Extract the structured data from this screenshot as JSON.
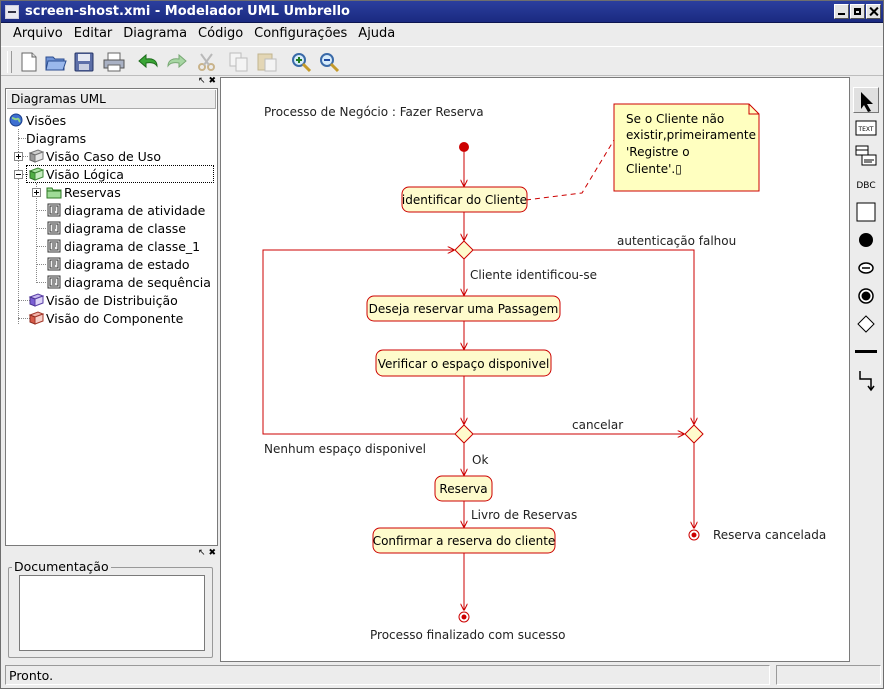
{
  "window": {
    "title": "screen-shost.xmi - Modelador UML Umbrello"
  },
  "menu": [
    "Arquivo",
    "Editar",
    "Diagrama",
    "Código",
    "Configurações",
    "Ajuda"
  ],
  "tree": {
    "header": "Diagramas UML",
    "root": "Visões",
    "diagrams": "Diagrams",
    "caso_de_uso": "Visão Caso de Uso",
    "logica": "Visão Lógica",
    "reservas": "Reservas",
    "diagrama_atividade": "diagrama de atividade",
    "diagrama_classe": "diagrama de classe",
    "diagrama_classe_1": "diagrama de classe_1",
    "diagrama_estado": "diagrama de estado",
    "diagrama_sequencia": "diagrama de sequência",
    "distribuicao": "Visão de Distribuição",
    "componente": "Visão do Componente"
  },
  "documentation": {
    "label": "Documentação",
    "value": ""
  },
  "diagram": {
    "title": "Processo de Negócio : Fazer Reserva",
    "note": [
      "Se o Cliente não",
      "existir,primeiramente",
      "'Registre o",
      "Cliente'.▯"
    ],
    "activities": {
      "identificar": "identificar do Cliente",
      "deseja": "Deseja reservar uma Passagem",
      "verificar": "Verificar o espaço disponivel",
      "reserva": "Reserva",
      "confirmar": "Confirmar a reserva do cliente"
    },
    "labels": {
      "autenticacao": "autenticação falhou",
      "cliente_identificou": "Cliente identificou-se",
      "cancelar": "cancelar",
      "nenhum_espaco": "Nenhum espaço disponivel",
      "ok": "Ok",
      "livro": "Livro de Reservas",
      "reserva_cancelada": "Reserva cancelada",
      "finalizado": "Processo finalizado com sucesso"
    }
  },
  "toolbox": {
    "text_tool": "TEXT",
    "dbc_tool": "DBC"
  },
  "status": {
    "text": "Pronto."
  },
  "colors": {
    "activity_fill": "#fefbcc",
    "line": "#cc0000",
    "note_fill": "#ffffc0"
  }
}
